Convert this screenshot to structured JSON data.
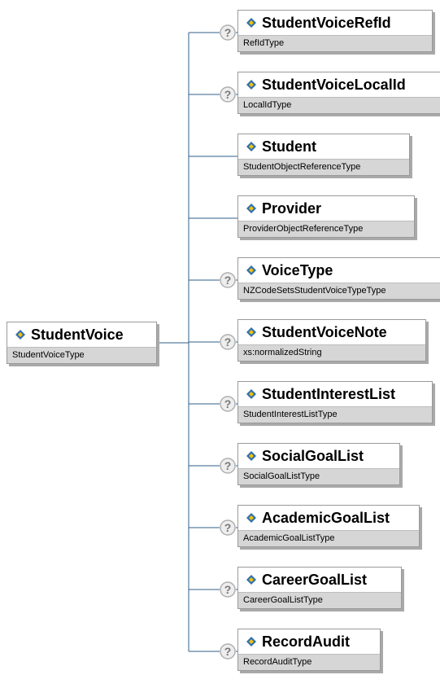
{
  "root": {
    "name": "StudentVoice",
    "type": "StudentVoiceType"
  },
  "children": [
    {
      "name": "StudentVoiceRefId",
      "type": "RefIdType",
      "optional": true
    },
    {
      "name": "StudentVoiceLocalId",
      "type": "LocalIdType",
      "optional": true
    },
    {
      "name": "Student",
      "type": "StudentObjectReferenceType",
      "optional": false
    },
    {
      "name": "Provider",
      "type": "ProviderObjectReferenceType",
      "optional": false
    },
    {
      "name": "VoiceType",
      "type": "NZCodeSetsStudentVoiceTypeType",
      "optional": true
    },
    {
      "name": "StudentVoiceNote",
      "type": "xs:normalizedString",
      "optional": true
    },
    {
      "name": "StudentInterestList",
      "type": "StudentInterestListType",
      "optional": true
    },
    {
      "name": "SocialGoalList",
      "type": "SocialGoalListType",
      "optional": true
    },
    {
      "name": "AcademicGoalList",
      "type": "AcademicGoalListType",
      "optional": true
    },
    {
      "name": "CareerGoalList",
      "type": "CareerGoalListType",
      "optional": true
    },
    {
      "name": "RecordAudit",
      "type": "RecordAuditType",
      "optional": true
    }
  ],
  "colors": {
    "connector": "#2f5f8a",
    "icon_fill": "#2f6fb0",
    "icon_accent": "#f2c200",
    "type_band": "#d6d6d6",
    "optional_icon": "#b0b0b0"
  }
}
